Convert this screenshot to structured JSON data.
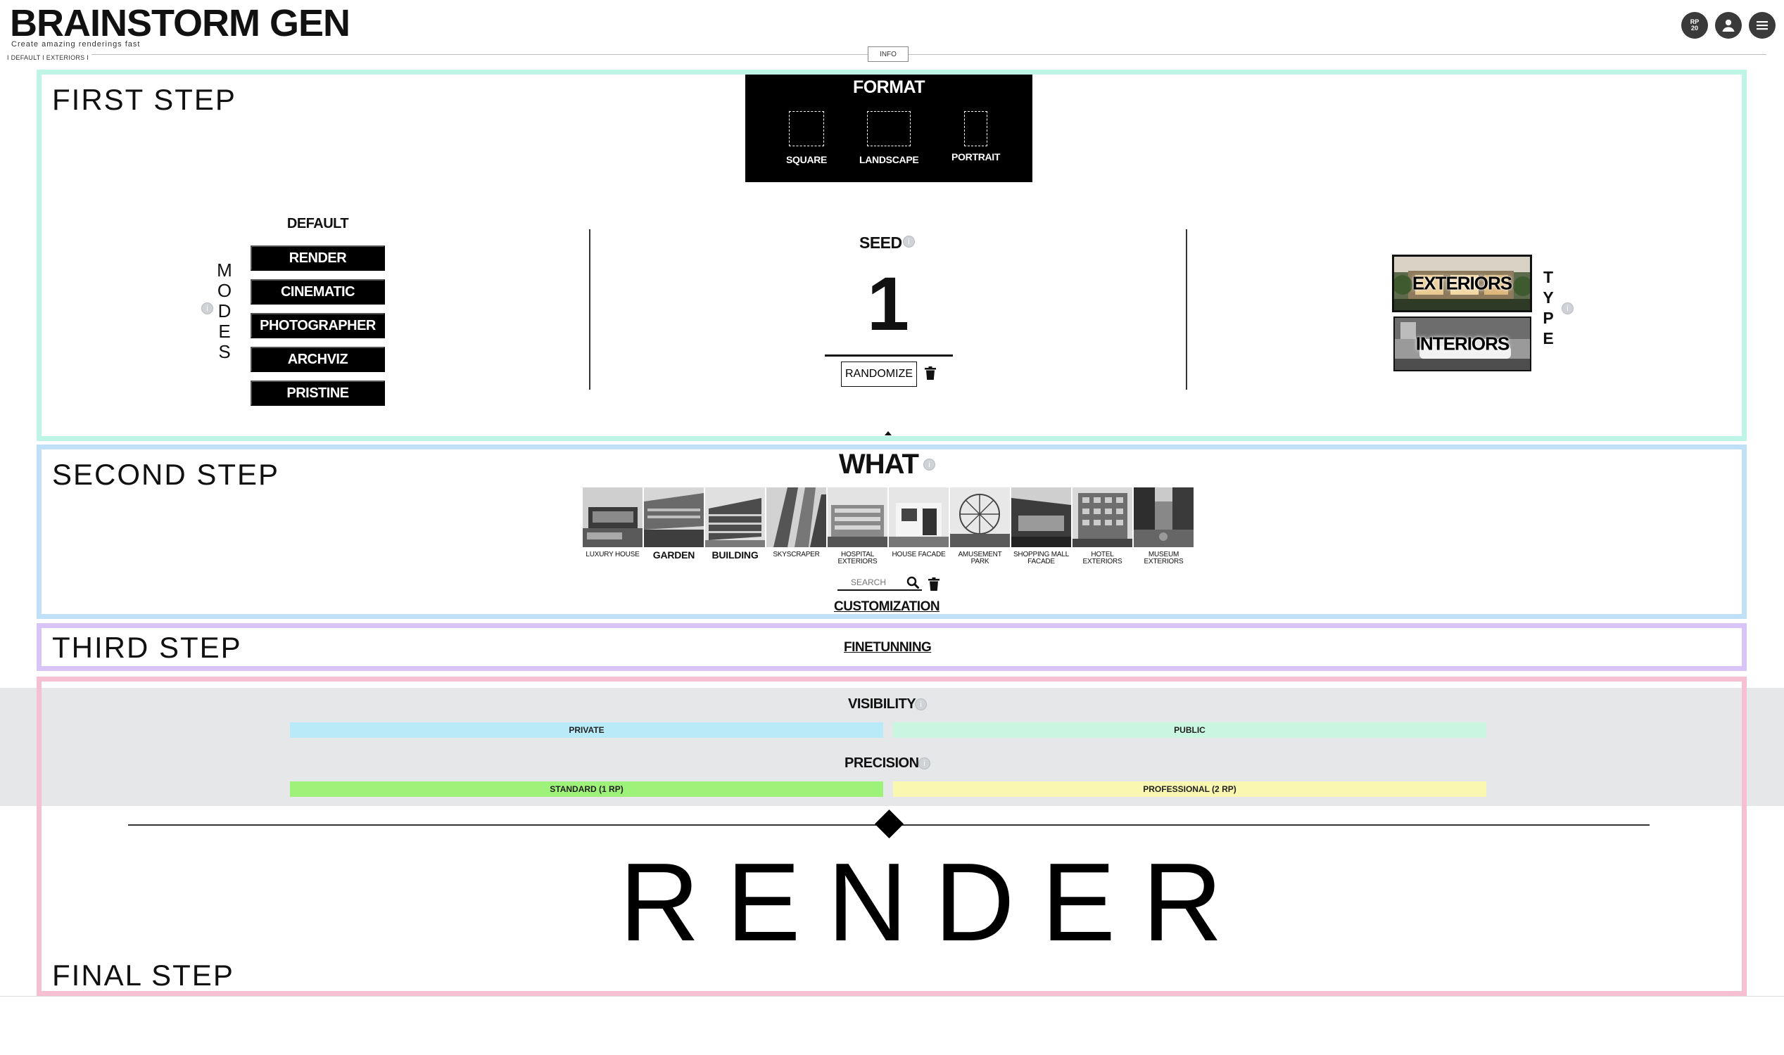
{
  "header": {
    "title": "BRAINSTORM GEN",
    "subtitle": "Create amazing renderings fast",
    "breadcrumb": "I DEFAULT I EXTERIORS I",
    "info_label": "INFO",
    "rp_top": "RP",
    "rp_value": "20"
  },
  "steps": {
    "first": "FIRST STEP",
    "second": "SECOND STEP",
    "third": "THIRD STEP",
    "final": "FINAL STEP"
  },
  "format": {
    "title": "FORMAT",
    "options": [
      "SQUARE",
      "LANDSCAPE",
      "PORTRAIT"
    ]
  },
  "modes": {
    "vertical_label": [
      "M",
      "O",
      "D",
      "E",
      "S"
    ],
    "current": "DEFAULT",
    "items": [
      "RENDER",
      "CINEMATIC",
      "PHOTOGRAPHER",
      "ARCHVIZ",
      "PRISTINE"
    ]
  },
  "seed": {
    "title": "SEED",
    "value": "1",
    "randomize_label": "RANDOMIZE"
  },
  "type": {
    "vertical_label": [
      "T",
      "Y",
      "P",
      "E"
    ],
    "items": [
      "EXTERIORS",
      "INTERIORS"
    ]
  },
  "what": {
    "title": "WHAT",
    "items": [
      "LUXURY HOUSE",
      "GARDEN",
      "BUILDING",
      "SKYSCRAPER",
      "HOSPITAL EXTERIORS",
      "HOUSE FACADE",
      "AMUSEMENT PARK",
      "SHOPPING MALL FACADE",
      "HOTEL EXTERIORS",
      "MUSEUM EXTERIORS"
    ],
    "search_placeholder": "SEARCH",
    "customization_label": "CUSTOMIZATION"
  },
  "third": {
    "finetuning_label": "FINETUNNING"
  },
  "final": {
    "visibility_title": "VISIBILITY",
    "visibility_private": "PRIVATE",
    "visibility_public": "PUBLIC",
    "precision_title": "PRECISION",
    "precision_standard": "STANDARD (1 RP)",
    "precision_professional": "PROFESSIONAL (2 RP)",
    "render_label": "RENDER"
  },
  "colors": {
    "step1": "#bff5e6",
    "step2": "#bfe0f7",
    "step3": "#d9c4f7",
    "step4": "#f7bfd2",
    "private": "#b8ebf7",
    "public": "#c9f5e1",
    "standard": "#9ef27a",
    "professional": "#f9f7b0"
  }
}
